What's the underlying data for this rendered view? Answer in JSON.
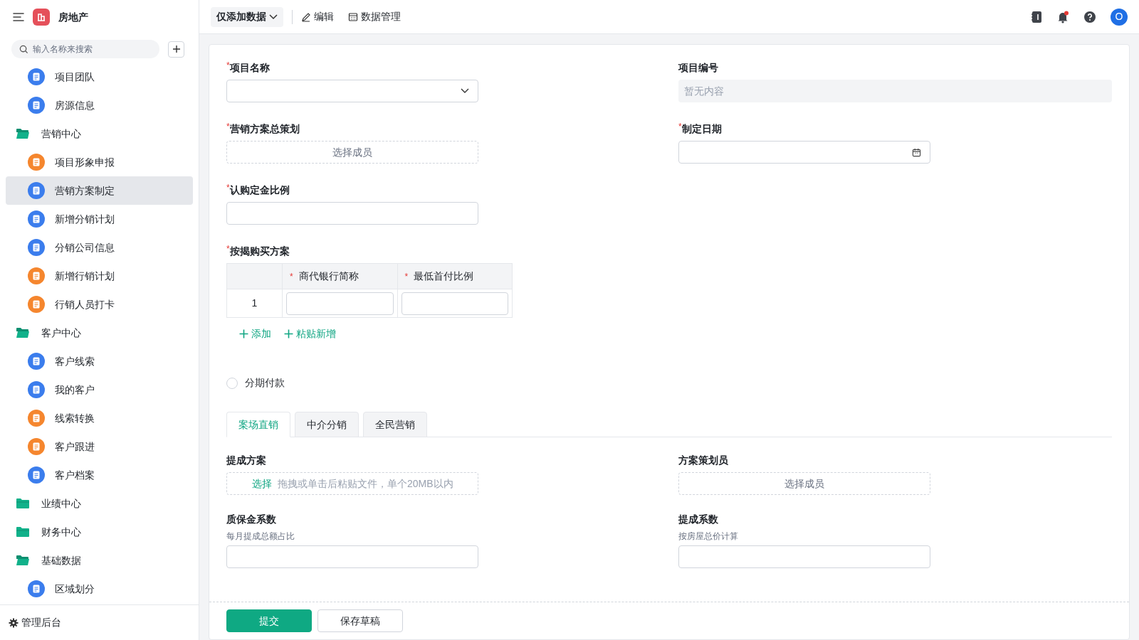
{
  "app": {
    "title": "房地产"
  },
  "sidebar": {
    "search": {
      "placeholder": "输入名称来搜索"
    },
    "items": [
      {
        "label": "项目团队",
        "kind": "page",
        "color": "#3b7ded",
        "selected": false
      },
      {
        "label": "房源信息",
        "kind": "page",
        "color": "#3b7ded",
        "selected": false
      },
      {
        "label": "营销中心",
        "kind": "folder",
        "selected": false,
        "expanded": true,
        "children": [
          {
            "label": "项目形象申报",
            "kind": "page",
            "color": "#f5862e",
            "selected": false
          },
          {
            "label": "营销方案制定",
            "kind": "page",
            "color": "#3b7ded",
            "selected": true
          },
          {
            "label": "新增分销计划",
            "kind": "page",
            "color": "#3b7ded",
            "selected": false
          },
          {
            "label": "分销公司信息",
            "kind": "page",
            "color": "#3b7ded",
            "selected": false
          },
          {
            "label": "新增行销计划",
            "kind": "page",
            "color": "#f5862e",
            "selected": false
          },
          {
            "label": "行销人员打卡",
            "kind": "page",
            "color": "#f5862e",
            "selected": false
          }
        ]
      },
      {
        "label": "客户中心",
        "kind": "folder",
        "selected": false,
        "expanded": true,
        "children": [
          {
            "label": "客户线索",
            "kind": "page",
            "color": "#3b7ded",
            "selected": false
          },
          {
            "label": "我的客户",
            "kind": "page",
            "color": "#3b7ded",
            "selected": false
          },
          {
            "label": "线索转换",
            "kind": "page",
            "color": "#f5862e",
            "selected": false
          },
          {
            "label": "客户跟进",
            "kind": "page",
            "color": "#f5862e",
            "selected": false
          },
          {
            "label": "客户档案",
            "kind": "page",
            "color": "#3b7ded",
            "selected": false
          }
        ]
      },
      {
        "label": "业绩中心",
        "kind": "folder",
        "selected": false,
        "expanded": false
      },
      {
        "label": "财务中心",
        "kind": "folder",
        "selected": false,
        "expanded": false
      },
      {
        "label": "基础数据",
        "kind": "folder",
        "selected": false,
        "expanded": true,
        "children": [
          {
            "label": "区域划分",
            "kind": "page",
            "color": "#3b7ded",
            "selected": false
          }
        ]
      }
    ],
    "footer": "管理后台"
  },
  "toolbar": {
    "view_menu": "仅添加数据",
    "actions": [
      {
        "label": "编辑",
        "kind": "edit"
      },
      {
        "label": "数据管理",
        "kind": "table"
      }
    ],
    "notifications_unread": true,
    "avatar": "O"
  },
  "form": {
    "required_mark": "*",
    "rows": [
      {
        "left": {
          "label": "项目名称",
          "required": true,
          "kind": "select"
        },
        "right": {
          "label": "项目编号",
          "required": false,
          "kind": "readonly",
          "placeholder": "暂无内容"
        }
      },
      {
        "left": {
          "label": "营销方案总策划",
          "required": true,
          "kind": "member",
          "placeholder": "选择成员"
        },
        "right": {
          "label": "制定日期",
          "required": true,
          "kind": "date"
        }
      },
      {
        "left": {
          "label": "认购定金比例",
          "required": true,
          "kind": "text"
        }
      }
    ],
    "mortgage": {
      "label": "按揭购买方案",
      "required": true,
      "columns": [
        {
          "label": "商代银行简称",
          "required": true
        },
        {
          "label": "最低首付比例",
          "required": true
        }
      ],
      "rows": [
        {
          "index": "1"
        }
      ],
      "actions": [
        "添加",
        "粘贴新增"
      ]
    },
    "installment": {
      "label": "分期付款",
      "checked": false
    },
    "tabs": [
      {
        "label": "案场直销",
        "selected": true
      },
      {
        "label": "中介分销",
        "selected": false
      },
      {
        "label": "全民营销",
        "selected": false
      }
    ],
    "tab_rows": [
      {
        "left": {
          "label": "提成方案",
          "required": false,
          "kind": "upload",
          "link": "选择",
          "placeholder": "拖拽或单击后粘贴文件，单个20MB以内"
        },
        "right": {
          "label": "方案策划员",
          "required": false,
          "kind": "member",
          "placeholder": "选择成员"
        }
      },
      {
        "left": {
          "label": "质保金系数",
          "required": false,
          "kind": "text",
          "description": "每月提成总额占比"
        },
        "right": {
          "label": "提成系数",
          "required": false,
          "kind": "text",
          "description": "按房屋总价计算"
        }
      }
    ],
    "buttons": [
      {
        "label": "提交",
        "kind": "primary"
      },
      {
        "label": "保存草稿",
        "kind": "secondary"
      }
    ]
  }
}
